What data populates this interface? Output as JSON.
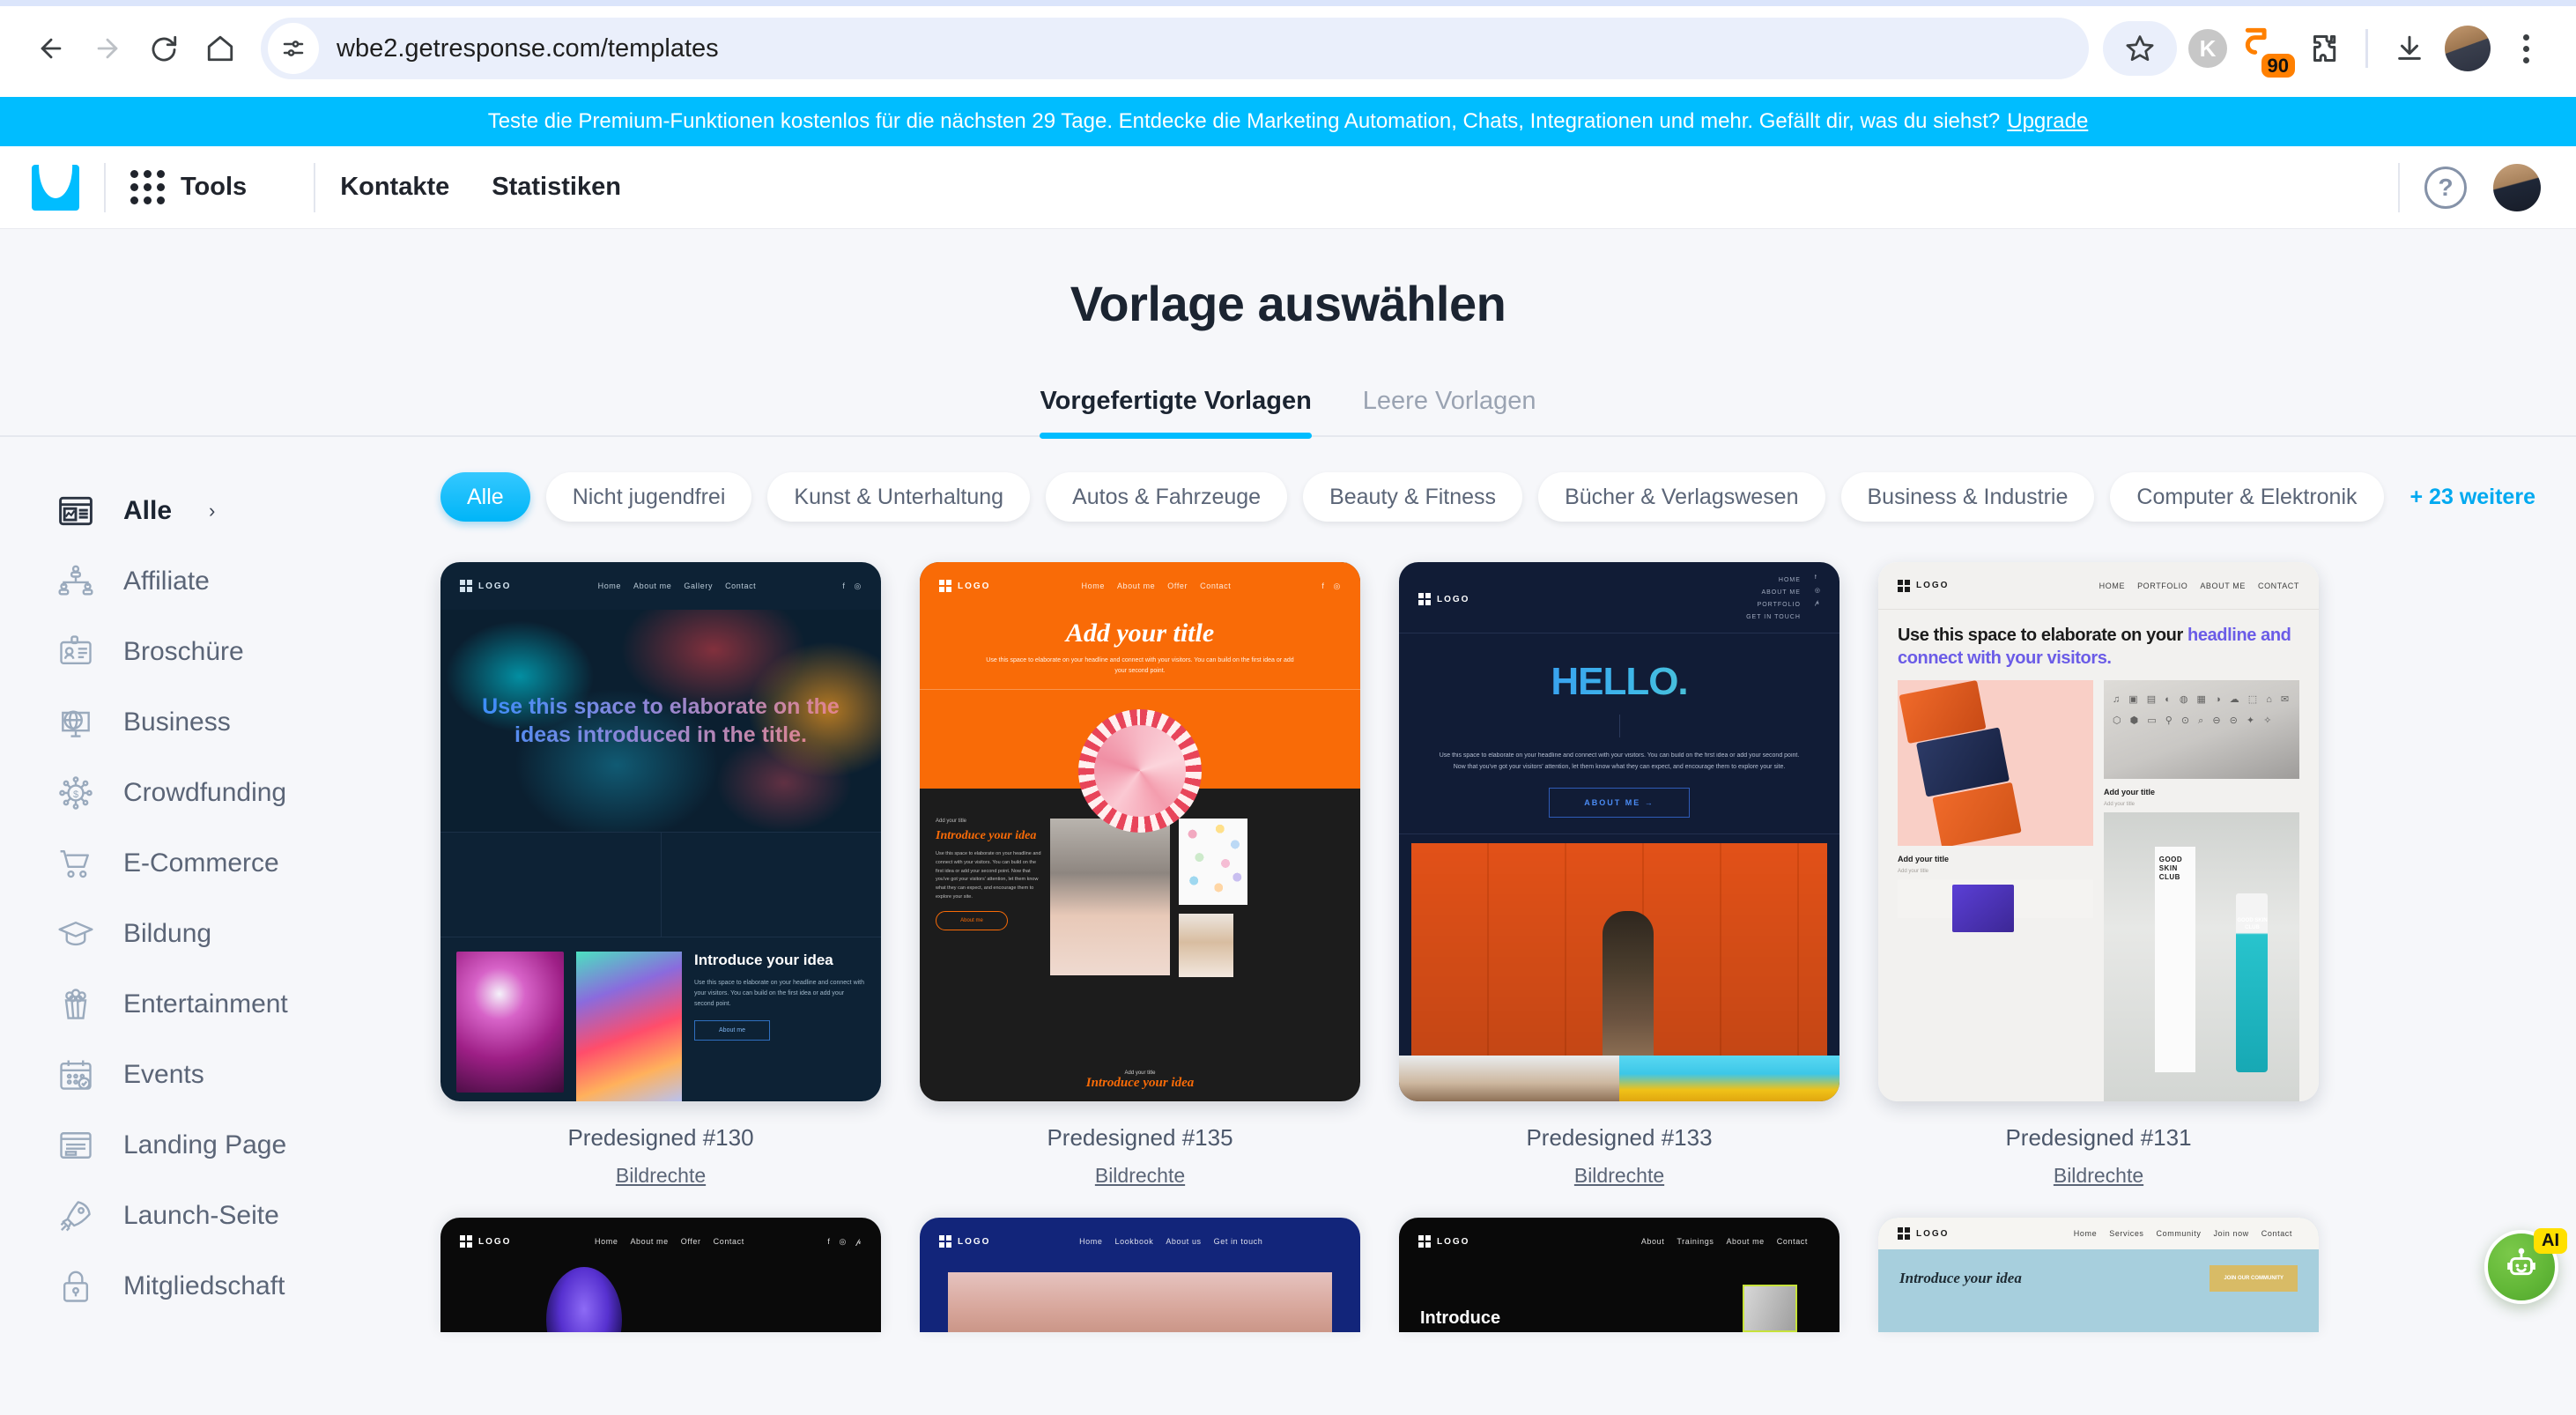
{
  "browser": {
    "url": "wbe2.getresponse.com/templates",
    "back_label": "Back",
    "forward_label": "Forward",
    "reload_label": "Reload",
    "home_label": "Home",
    "site_info_label": "View site information",
    "bookmark_label": "Bookmark this tab",
    "profile_k_label": "K",
    "extension_badge": "90",
    "extensions_label": "Extensions",
    "downloads_label": "Downloads",
    "avatar_label": "Profile",
    "menu_label": "Customize and control"
  },
  "promo": {
    "text": "Teste die Premium-Funktionen kostenlos für die nächsten 29 Tage. Entdecke die Marketing Automation, Chats, Integrationen und mehr. Gefällt dir, was du siehst?",
    "link": "Upgrade",
    "bg_color": "#00bdff"
  },
  "app_header": {
    "logo_label": "GetResponse",
    "tools_label": "Tools",
    "links": [
      "Kontakte",
      "Statistiken"
    ],
    "help_label": "?",
    "avatar_label": "Benutzerkonto"
  },
  "page": {
    "title": "Vorlage auswählen",
    "tabs": [
      {
        "label": "Vorgefertigte Vorlagen",
        "active": true
      },
      {
        "label": "Leere Vorlagen",
        "active": false
      }
    ],
    "accent_color": "#00bdff"
  },
  "sidebar": {
    "items": [
      {
        "label": "Alle",
        "icon": "browser-chart-icon",
        "active": true,
        "caret": "›"
      },
      {
        "label": "Affiliate",
        "icon": "network-users-icon",
        "active": false
      },
      {
        "label": "Broschüre",
        "icon": "id-card-icon",
        "active": false
      },
      {
        "label": "Business",
        "icon": "globe-monitor-icon",
        "active": false
      },
      {
        "label": "Crowdfunding",
        "icon": "dollar-network-icon",
        "active": false
      },
      {
        "label": "E-Commerce",
        "icon": "shopping-cart-icon",
        "active": false
      },
      {
        "label": "Bildung",
        "icon": "graduation-cap-icon",
        "active": false
      },
      {
        "label": "Entertainment",
        "icon": "popcorn-icon",
        "active": false
      },
      {
        "label": "Events",
        "icon": "calendar-check-icon",
        "active": false
      },
      {
        "label": "Landing Page",
        "icon": "landing-page-icon",
        "active": false
      },
      {
        "label": "Launch-Seite",
        "icon": "rocket-icon",
        "active": false
      },
      {
        "label": "Mitgliedschaft",
        "icon": "lock-icon",
        "active": false
      }
    ]
  },
  "filters": {
    "chips": [
      {
        "label": "Alle",
        "active": true
      },
      {
        "label": "Nicht jugendfrei",
        "active": false
      },
      {
        "label": "Kunst & Unterhaltung",
        "active": false
      },
      {
        "label": "Autos & Fahrzeuge",
        "active": false
      },
      {
        "label": "Beauty & Fitness",
        "active": false
      },
      {
        "label": "Bücher & Verlagswesen",
        "active": false
      },
      {
        "label": "Business & Industrie",
        "active": false
      },
      {
        "label": "Computer & Elektronik",
        "active": false
      }
    ],
    "more_label": "+ 23 weitere"
  },
  "templates": [
    {
      "name": "Predesigned #130",
      "credit": "Bildrechte",
      "logo": "LOGO",
      "nav": [
        "Home",
        "About me",
        "Gallery",
        "Contact"
      ],
      "headline": "Use this space to elaborate on the ideas introduced in the title.",
      "section_title": "Introduce your idea",
      "section_body": "Use this space to elaborate on your headline and connect with your visitors. You can build on the first idea or add your second point.",
      "button": "About me"
    },
    {
      "name": "Predesigned #135",
      "credit": "Bildrechte",
      "logo": "LOGO",
      "nav": [
        "Home",
        "About me",
        "Offer",
        "Contact"
      ],
      "headline": "Add your title",
      "subhead": "Use this space to elaborate on your headline and connect with your visitors. You can build on the first idea or add your second point.",
      "eyebrow": "Add your title",
      "section_title": "Introduce your idea",
      "section_body": "Use this space to elaborate on your headline and connect with your visitors. You can build on the first idea or add your second point. Now that you've got your visitors' attention, let them know what they can expect, and encourage them to explore your site.",
      "button": "About me",
      "footer_eyebrow": "Add your title",
      "footer_title": "Introduce your idea"
    },
    {
      "name": "Predesigned #133",
      "credit": "Bildrechte",
      "logo": "LOGO",
      "nav": [
        "HOME",
        "ABOUT ME",
        "PORTFOLIO",
        "GET IN TOUCH"
      ],
      "headline": "HELLO.",
      "body": "Use this space to elaborate on your headline and connect with your visitors. You can build on the first idea or add your second point. Now that you've got your visitors' attention, let them know what they can expect, and encourage them to explore your site.",
      "button": "ABOUT ME →"
    },
    {
      "name": "Predesigned #131",
      "credit": "Bildrechte",
      "logo": "LOGO",
      "nav": [
        "HOME",
        "PORTFOLIO",
        "ABOUT ME",
        "CONTACT"
      ],
      "headline_dark": "Use this space to elaborate on your",
      "headline_purple": "headline and connect with your visitors.",
      "caption_1": "Add your title",
      "caption_1_sub": "Add your title",
      "caption_2": "Add your title",
      "caption_2_sub": "Add your title",
      "product_text": "GOOD SKIN CLUB",
      "product_side": "WE ALL BELONG"
    }
  ],
  "templates_partial": [
    {
      "logo": "LOGO",
      "nav": [
        "Home",
        "About me",
        "Offer",
        "Contact"
      ]
    },
    {
      "logo": "LOGO",
      "nav": [
        "Home",
        "Lookbook",
        "About us",
        "Get in touch"
      ]
    },
    {
      "logo": "LOGO",
      "nav": [
        "About",
        "Trainings",
        "About me",
        "Contact"
      ],
      "title": "Introduce"
    },
    {
      "logo": "LOGO",
      "nav": [
        "Home",
        "Services",
        "Community",
        "Join now",
        "Contact"
      ],
      "title": "Introduce your idea",
      "button": "JOIN OUR COMMUNITY"
    }
  ],
  "ai_widget": {
    "badge": "AI",
    "label": "AI Assistent",
    "color": "#63b838"
  }
}
